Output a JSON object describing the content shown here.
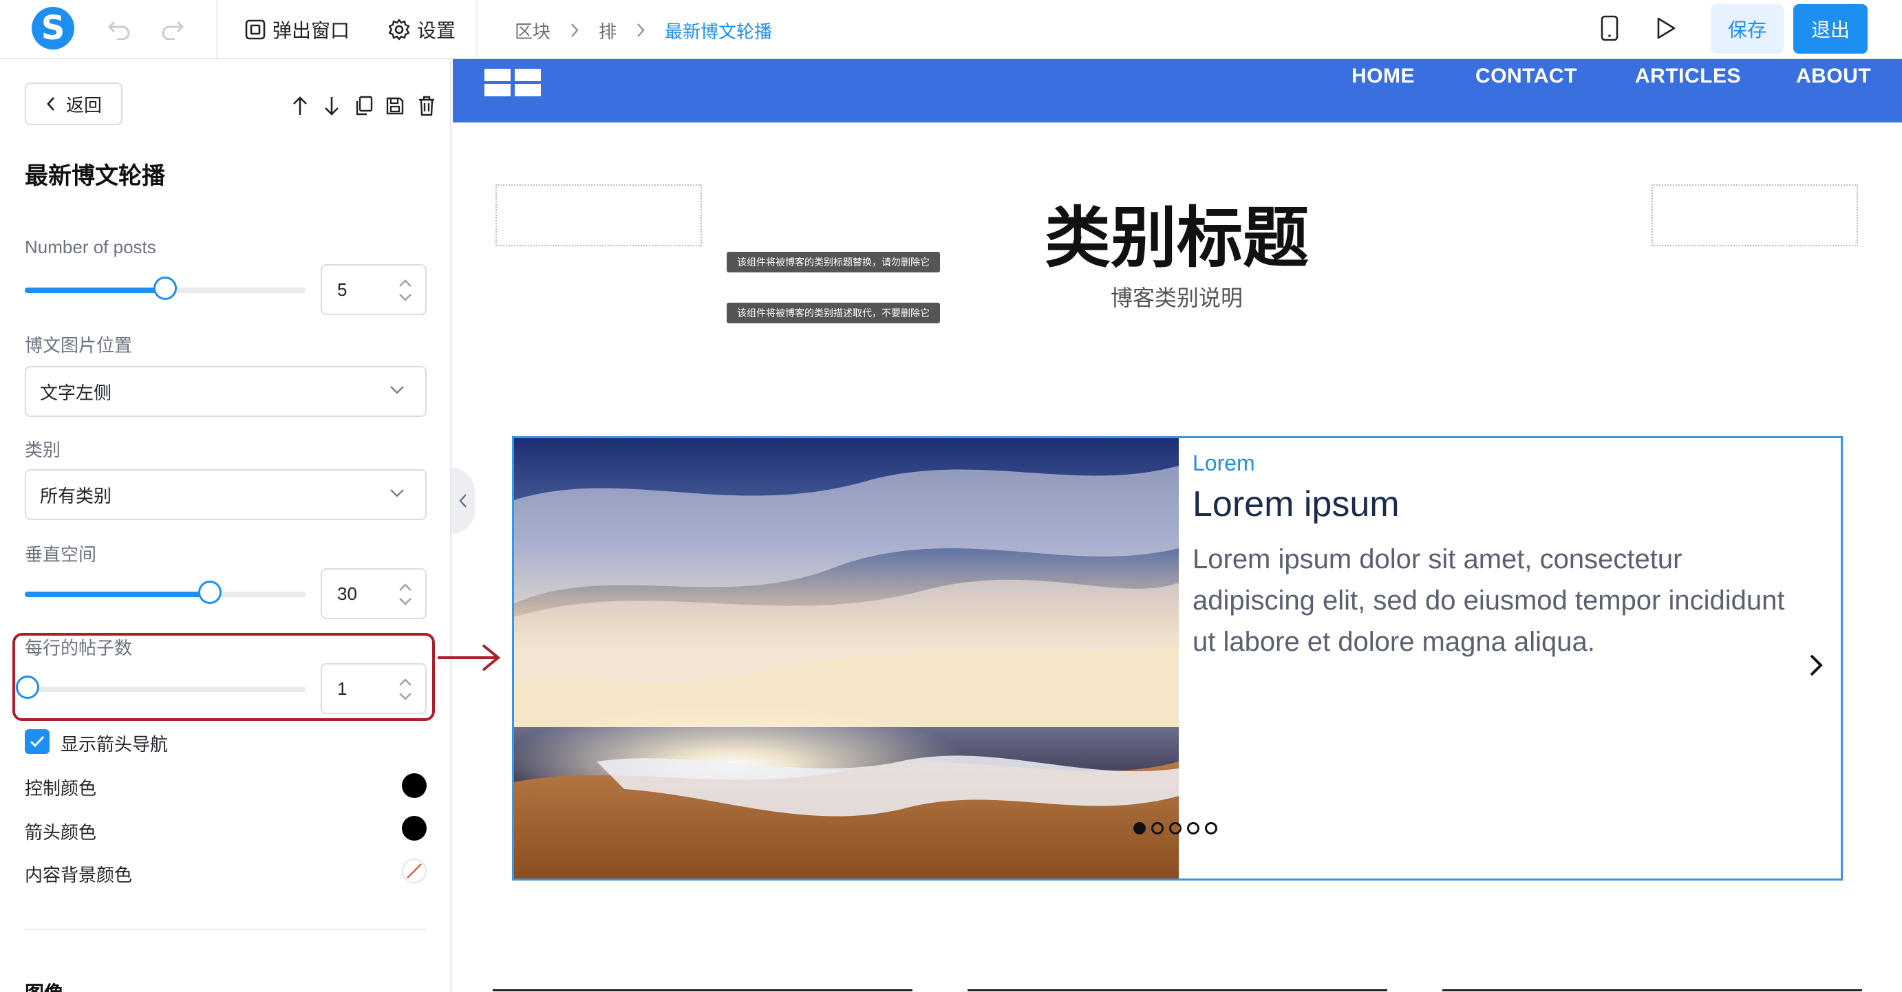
{
  "topbar": {
    "logo_letter": "S",
    "popup_label": "弹出窗口",
    "settings_label": "设置",
    "breadcrumb": [
      "区块",
      "排",
      "最新博文轮播"
    ],
    "save_label": "保存",
    "exit_label": "退出"
  },
  "panel": {
    "back_label": "返回",
    "title": "最新博文轮播",
    "number_of_posts": {
      "label": "Number of posts",
      "value": "5",
      "level": 0.5
    },
    "image_position": {
      "label": "博文图片位置",
      "value": "文字左侧"
    },
    "category": {
      "label": "类别",
      "value": "所有类别"
    },
    "vertical_space": {
      "label": "垂直空间",
      "value": "30",
      "level": 0.66
    },
    "posts_per_row": {
      "label": "每行的帖子数",
      "value": "1",
      "level": 0.0
    },
    "show_arrows": {
      "label": "显示箭头导航",
      "checked": true
    },
    "control_color": {
      "label": "控制颜色",
      "color": "#000000"
    },
    "arrow_color": {
      "label": "箭头颜色",
      "color": "#000000"
    },
    "content_bg_color": {
      "label": "内容背景颜色",
      "color": "none"
    },
    "section_image": "图像"
  },
  "canvas": {
    "nav_links": [
      "HOME",
      "CONTACT",
      "ARTICLES",
      "ABOUT"
    ],
    "category_title": "类别标题",
    "category_desc": "博客类别说明",
    "tooltip_title": "该组件将被博客的类别标题替换，请勿删除它",
    "tooltip_desc": "该组件将被博客的类别描述取代，不要删除它",
    "post": {
      "category": "Lorem",
      "title": "Lorem ipsum",
      "excerpt": "Lorem ipsum dolor sit amet, consectetur adipiscing elit, sed do eiusmod tempor incididunt ut labore et dolore magna aliqua."
    },
    "dots_count": 5,
    "active_dot": 0
  },
  "colors": {
    "accent": "#1d8ff0",
    "nav_bg": "#3a6fe0",
    "highlight": "#a82127"
  }
}
